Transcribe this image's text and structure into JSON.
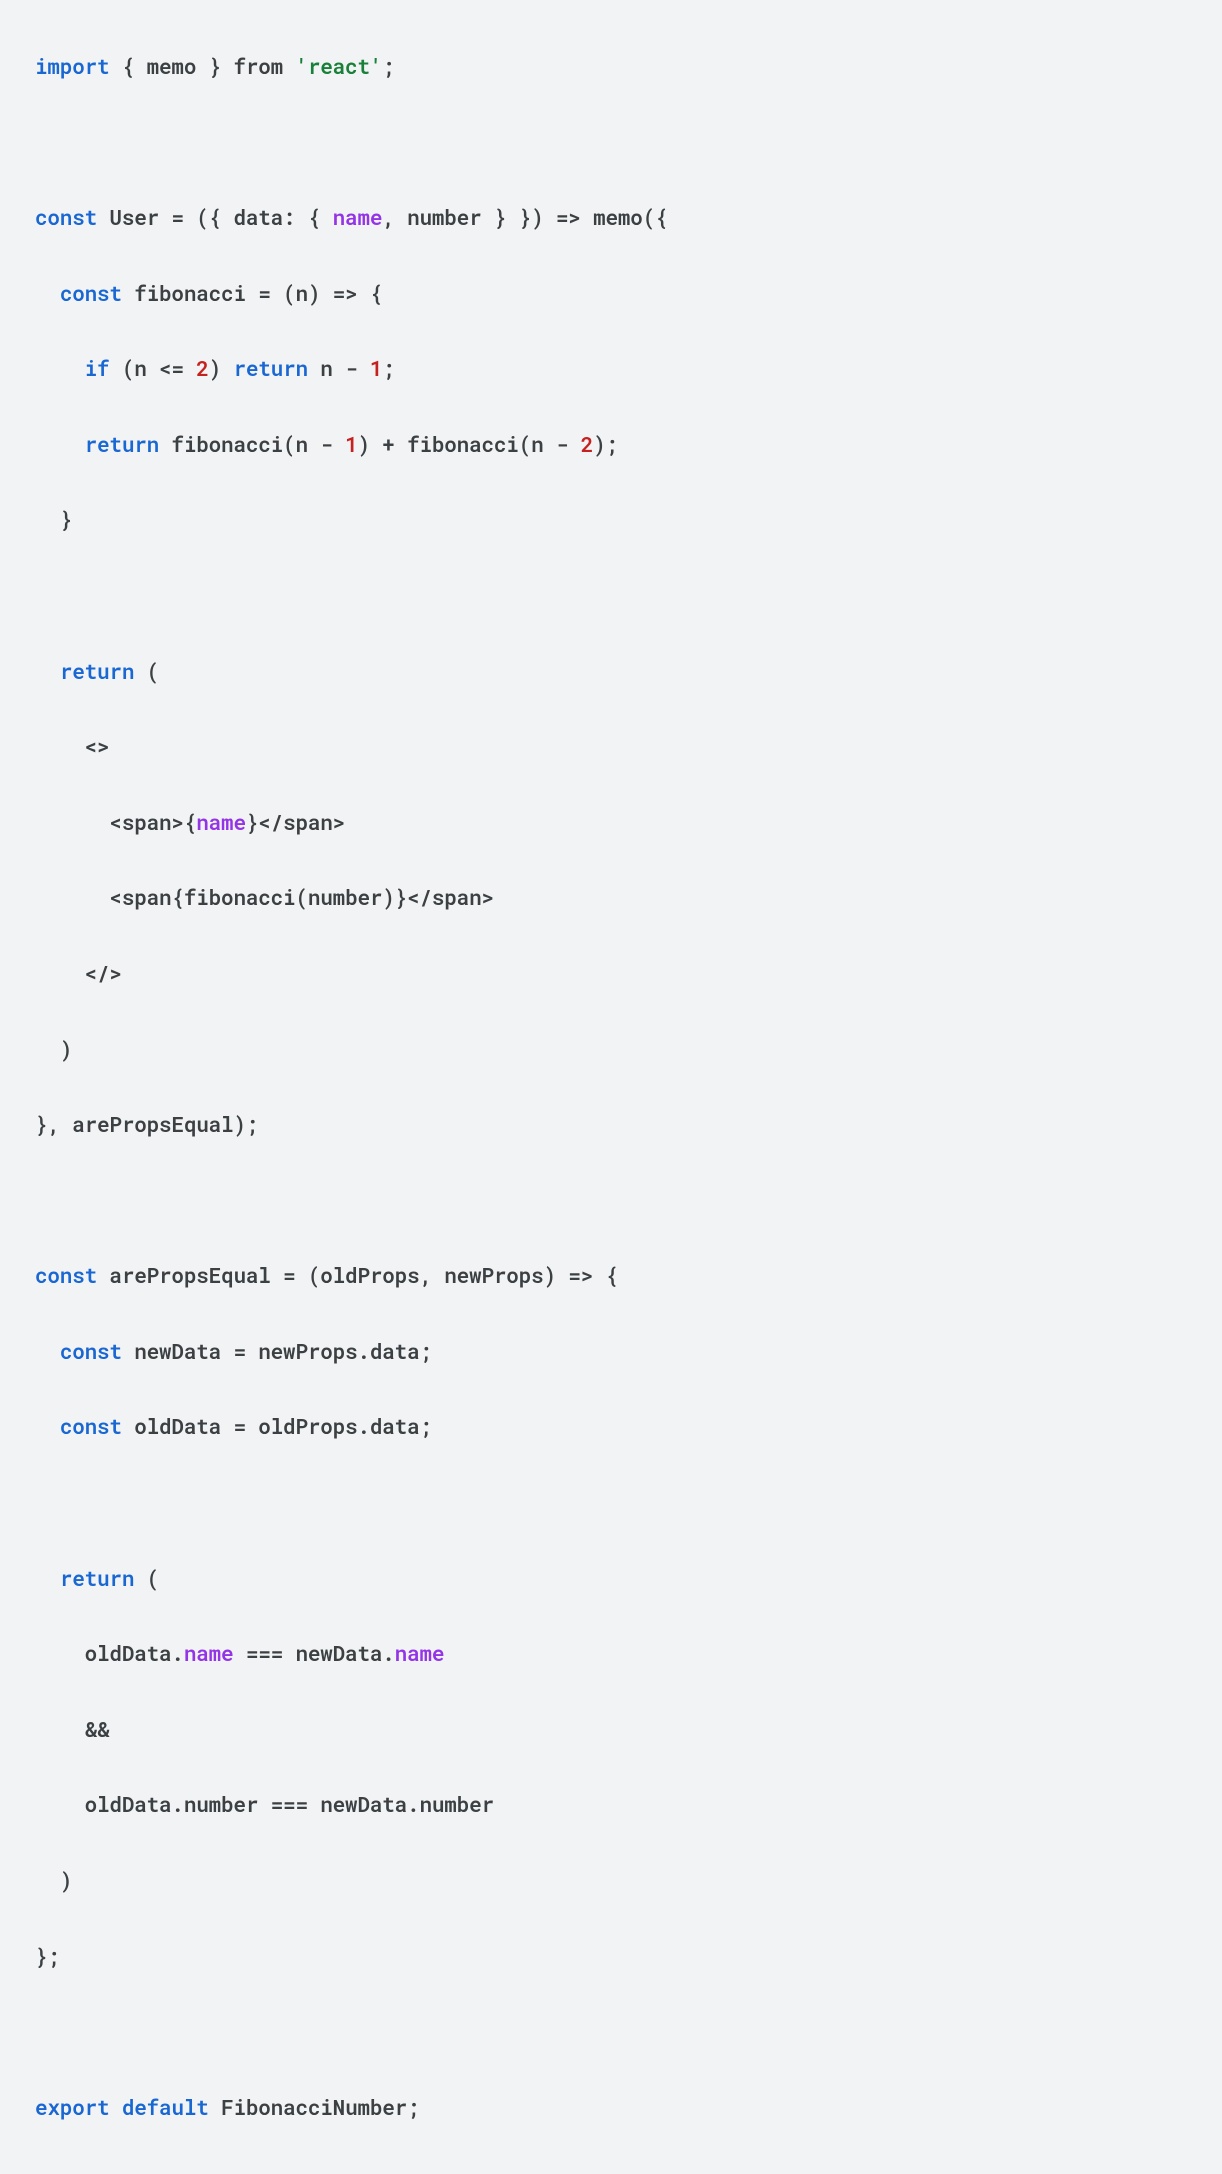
{
  "code": {
    "line1": {
      "t1": "import",
      "t2": " { memo } from ",
      "t3": "'react'",
      "t4": ";"
    },
    "line3": {
      "t1": "const",
      "t2": " User = ({ data: { ",
      "t3": "name",
      "t4": ", number } }) => memo({"
    },
    "line4": {
      "t1": "  ",
      "t2": "const",
      "t3": " fibonacci = (n) => {"
    },
    "line5": {
      "t1": "    ",
      "t2": "if",
      "t3": " (n <= ",
      "t4": "2",
      "t5": ") ",
      "t6": "return",
      "t7": " n - ",
      "t8": "1",
      "t9": ";"
    },
    "line6": {
      "t1": "    ",
      "t2": "return",
      "t3": " fibonacci(n - ",
      "t4": "1",
      "t5": ") + fibonacci(n - ",
      "t6": "2",
      "t7": ");"
    },
    "line7": {
      "t1": "  }"
    },
    "line9": {
      "t1": "  ",
      "t2": "return",
      "t3": " ("
    },
    "line10": {
      "t1": "    <>"
    },
    "line11": {
      "t1": "      ",
      "t2": "<span>",
      "t3": "{",
      "t4": "name",
      "t5": "}",
      "t6": "</span>"
    },
    "line12": {
      "t1": "      ",
      "t2": "<span",
      "t3": "{fibonacci(number)}",
      "t4": "</span>"
    },
    "line13": {
      "t1": "    </>"
    },
    "line14": {
      "t1": "  )"
    },
    "line15": {
      "t1": "}, arePropsEqual);"
    },
    "line17": {
      "t1": "const",
      "t2": " arePropsEqual = (oldProps, newProps) => {"
    },
    "line18": {
      "t1": "  ",
      "t2": "const",
      "t3": " newData = newProps.data;"
    },
    "line19": {
      "t1": "  ",
      "t2": "const",
      "t3": " oldData = oldProps.data;"
    },
    "line21": {
      "t1": "  ",
      "t2": "return",
      "t3": " ("
    },
    "line22": {
      "t1": "    oldData.",
      "t2": "name",
      "t3": " === newData.",
      "t4": "name"
    },
    "line23": {
      "t1": "    &&"
    },
    "line24": {
      "t1": "    oldData.number === newData.number"
    },
    "line25": {
      "t1": "  )"
    },
    "line26": {
      "t1": "};"
    },
    "line28": {
      "t1": "export",
      "t2": " ",
      "t3": "default",
      "t4": " FibonacciNumber;"
    }
  }
}
